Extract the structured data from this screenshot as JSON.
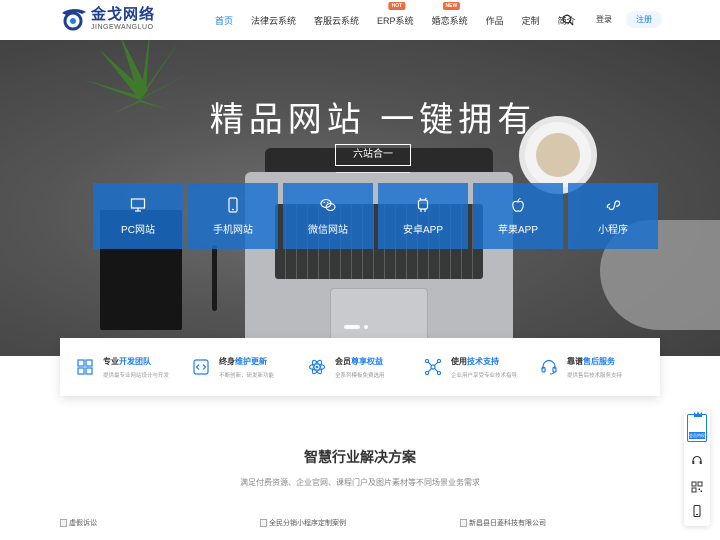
{
  "brand": {
    "name_cn": "金戈网络",
    "name_en": "JINGEWANGLUO",
    "accent": "#1e7ef0"
  },
  "nav": {
    "items": [
      {
        "label": "首页",
        "active": true
      },
      {
        "label": "法律云系统"
      },
      {
        "label": "客服云系统"
      },
      {
        "label": "ERP系统",
        "badge": "HOT"
      },
      {
        "label": "婚恋系统",
        "badge": "NEW"
      },
      {
        "label": "作品"
      },
      {
        "label": "定制"
      },
      {
        "label": "简介"
      }
    ],
    "login": "登录",
    "register": "注册",
    "search_icon": "search-icon"
  },
  "hero": {
    "title": "精品网站 一键拥有",
    "subtitle": "六站合一",
    "tiles": [
      {
        "label": "PC网站",
        "icon": "monitor-icon"
      },
      {
        "label": "手机网站",
        "icon": "mobile-icon"
      },
      {
        "label": "微信网站",
        "icon": "wechat-icon"
      },
      {
        "label": "安卓APP",
        "icon": "android-icon"
      },
      {
        "label": "苹果APP",
        "icon": "apple-icon"
      },
      {
        "label": "小程序",
        "icon": "miniprogram-icon"
      }
    ],
    "tile_color": "#1870d0"
  },
  "features": [
    {
      "title_a": "专业",
      "title_b": "开发团队",
      "desc": "提供最专业网站设计与开发",
      "icon": "team-icon"
    },
    {
      "title_a": "终身",
      "title_b": "维护更新",
      "desc": "不断创新，研发新功能",
      "icon": "code-icon"
    },
    {
      "title_a": "会员",
      "title_b": "尊享权益",
      "desc": "全系列模板免费选用",
      "icon": "atom-icon"
    },
    {
      "title_a": "使用",
      "title_b": "技术支持",
      "desc": "企业用户享受专业技术指导",
      "icon": "network-icon"
    },
    {
      "title_a": "靠谱",
      "title_b": "售后服务",
      "desc": "提供售后技术服务支持",
      "icon": "headset-icon"
    }
  ],
  "solutions": {
    "title": "智慧行业解决方案",
    "desc": "满足付费资源、企业官网、课程门户及图片素材等不同场景业务需求",
    "cases": [
      "虚假诉讼",
      "全民分销小程序定制案例",
      "新昌县日菱科技有限公司"
    ]
  },
  "side": {
    "member_label": "会员特权"
  }
}
